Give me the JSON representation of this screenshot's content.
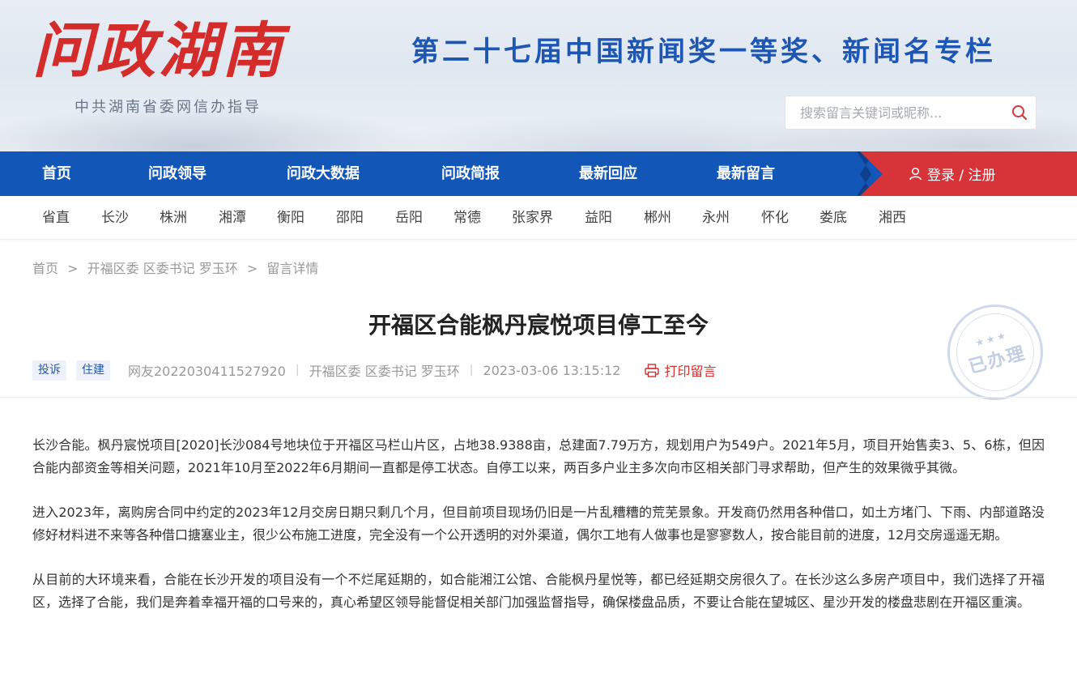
{
  "header": {
    "logo": "问政湖南",
    "subtitle": "中共湖南省委网信办指导",
    "slogan": "第二十七届中国新闻奖一等奖、新闻名专栏",
    "search_placeholder": "搜索留言关键词或昵称...",
    "search_icon": "search-icon"
  },
  "nav": {
    "items": [
      "首页",
      "问政领导",
      "问政大数据",
      "问政简报",
      "最新回应",
      "最新留言"
    ],
    "login_label": "登录 / 注册",
    "login_icon": "user-icon"
  },
  "regions": [
    "省直",
    "长沙",
    "株洲",
    "湘潭",
    "衡阳",
    "邵阳",
    "岳阳",
    "常德",
    "张家界",
    "益阳",
    "郴州",
    "永州",
    "怀化",
    "娄底",
    "湘西"
  ],
  "breadcrumb": {
    "home": "首页",
    "sep": ">",
    "level2": "开福区委 区委书记 罗玉环",
    "level3": "留言详情"
  },
  "article": {
    "title": "开福区合能枫丹宸悦项目停工至今",
    "tags": [
      "投诉",
      "住建"
    ],
    "author": "网友2022030411527920",
    "target": "开福区委 区委书记 罗玉环",
    "datetime": "2023-03-06 13:15:12",
    "print_label": "打印留言",
    "stamp_text": "已办理",
    "stamp_stars": "★★★",
    "paragraphs": [
      "长沙合能。枫丹宸悦项目[2020]长沙084号地块位于开福区马栏山片区，占地38.9388亩，总建面7.79万方，规划用户为549户。2021年5月，项目开始售卖3、5、6栋，但因合能内部资金等相关问题，2021年10月至2022年6月期间一直都是停工状态。自停工以来，两百多户业主多次向市区相关部门寻求帮助，但产生的效果微乎其微。",
      "进入2023年，离购房合同中约定的2023年12月交房日期只剩几个月，但目前项目现场仍旧是一片乱糟糟的荒芜景象。开发商仍然用各种借口，如土方堵门、下雨、内部道路没修好材料进不来等各种借口搪塞业主，很少公布施工进度，完全没有一个公开透明的对外渠道，偶尔工地有人做事也是寥寥数人，按合能目前的进度，12月交房遥遥无期。",
      "从目前的大环境来看，合能在长沙开发的项目没有一个不烂尾延期的，如合能湘江公馆、合能枫丹星悦等，都已经延期交房很久了。在长沙这么多房产项目中，我们选择了开福区，选择了合能，我们是奔着幸福开福的口号来的，真心希望区领导能督促相关部门加强监督指导，确保楼盘品质，不要让合能在望城区、星沙开发的楼盘悲剧在开福区重演。"
    ]
  },
  "colors": {
    "nav_blue": "#1257b8",
    "login_red": "#d7343a",
    "logo_red": "#d42b2b",
    "slogan_blue": "#1e56b3"
  }
}
